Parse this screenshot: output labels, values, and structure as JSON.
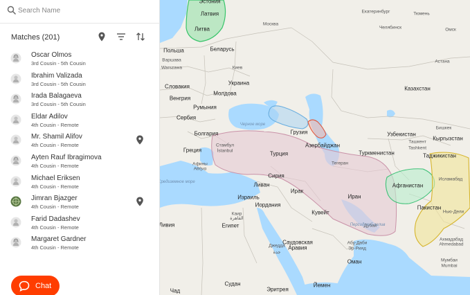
{
  "search": {
    "placeholder": "Search Name"
  },
  "matches": {
    "title": "Matches (201)"
  },
  "colors": {
    "accent": "#ff3d00",
    "sea": "#aadaff",
    "land": "#f1efe9",
    "pin": "#555555"
  },
  "match_list": [
    {
      "name": "Oscar Olmos",
      "relation": "3rd Cousin - 5th Cousin",
      "avatar": "female-avatar-icon",
      "pinned": false
    },
    {
      "name": "Ibrahim Valizada",
      "relation": "3rd Cousin - 5th Cousin",
      "avatar": "male-avatar-icon",
      "pinned": false
    },
    {
      "name": "Irada Balagaeva",
      "relation": "3rd Cousin - 5th Cousin",
      "avatar": "female-avatar-icon",
      "pinned": false
    },
    {
      "name": "Eldar Adilov",
      "relation": "4th Cousin - Remote",
      "avatar": "male-avatar-icon",
      "pinned": false
    },
    {
      "name": "Mr. Shamil Alifov",
      "relation": "4th Cousin - Remote",
      "avatar": "male-avatar-icon",
      "pinned": true
    },
    {
      "name": "Ayten Rauf Ibragimova",
      "relation": "4th Cousin - Remote",
      "avatar": "female-avatar-icon",
      "pinned": false
    },
    {
      "name": "Michael Eriksen",
      "relation": "4th Cousin - Remote",
      "avatar": "male-avatar-icon",
      "pinned": false
    },
    {
      "name": "Jimran Bjazger",
      "relation": "4th Cousin - Remote",
      "avatar": "photo-avatar-icon",
      "pinned": true
    },
    {
      "name": "Farid Dadashev",
      "relation": "4th Cousin - Remote",
      "avatar": "male-avatar-icon",
      "pinned": false
    },
    {
      "name": "Margaret Gardner",
      "relation": "4th Cousin - Remote",
      "avatar": "female-avatar-icon",
      "pinned": false
    }
  ],
  "chat": {
    "label": "Chat"
  },
  "map_labels": [
    {
      "text": "Эстония",
      "kind": "country"
    },
    {
      "text": "Латвия",
      "kind": "country"
    },
    {
      "text": "Литва",
      "kind": "country"
    },
    {
      "text": "Москва",
      "kind": "city"
    },
    {
      "text": "Екатеринбург",
      "kind": "city"
    },
    {
      "text": "Тюмень",
      "kind": "city"
    },
    {
      "text": "Челябинск",
      "kind": "city"
    },
    {
      "text": "Омск",
      "kind": "city"
    },
    {
      "text": "Польша",
      "kind": "country"
    },
    {
      "text": "Варшава",
      "kind": "city"
    },
    {
      "text": "Warszawa",
      "kind": "city"
    },
    {
      "text": "Беларусь",
      "kind": "country"
    },
    {
      "text": "Киев",
      "kind": "city"
    },
    {
      "text": "Украина",
      "kind": "country"
    },
    {
      "text": "Астана",
      "kind": "city"
    },
    {
      "text": "Словакия",
      "kind": "country"
    },
    {
      "text": "Венгрия",
      "kind": "country"
    },
    {
      "text": "Молдова",
      "kind": "country"
    },
    {
      "text": "Казахстан",
      "kind": "country"
    },
    {
      "text": "Румыния",
      "kind": "country"
    },
    {
      "text": "Сербия",
      "kind": "country"
    },
    {
      "text": "Болгария",
      "kind": "country"
    },
    {
      "text": "Черное море",
      "kind": "sea"
    },
    {
      "text": "Грузия",
      "kind": "country"
    },
    {
      "text": "Узбекистан",
      "kind": "country"
    },
    {
      "text": "Бишкек",
      "kind": "city"
    },
    {
      "text": "Кыргызстан",
      "kind": "country"
    },
    {
      "text": "Ташкент",
      "kind": "city"
    },
    {
      "text": "Tashkent",
      "kind": "city"
    },
    {
      "text": "Азербайджан",
      "kind": "country"
    },
    {
      "text": "Туркменистан",
      "kind": "country"
    },
    {
      "text": "Греция",
      "kind": "country"
    },
    {
      "text": "Стамбул",
      "kind": "city"
    },
    {
      "text": "İstanbul",
      "kind": "city"
    },
    {
      "text": "Турция",
      "kind": "country"
    },
    {
      "text": "Таджикистан",
      "kind": "country"
    },
    {
      "text": "Афины",
      "kind": "city"
    },
    {
      "text": "Αθήνα",
      "kind": "city"
    },
    {
      "text": "Тегеран",
      "kind": "city"
    },
    {
      "text": "Средиземное море",
      "kind": "sea"
    },
    {
      "text": "Сирия",
      "kind": "country"
    },
    {
      "text": "Ливан",
      "kind": "country"
    },
    {
      "text": "Афганистан",
      "kind": "country"
    },
    {
      "text": "Исламабад",
      "kind": "city"
    },
    {
      "text": "Ирак",
      "kind": "country"
    },
    {
      "text": "Израиль",
      "kind": "country"
    },
    {
      "text": "Иран",
      "kind": "country"
    },
    {
      "text": "Иордания",
      "kind": "country"
    },
    {
      "text": "Кувейт",
      "kind": "country"
    },
    {
      "text": "Пакистан",
      "kind": "country"
    },
    {
      "text": "Нью-Дели",
      "kind": "city"
    },
    {
      "text": "Каир",
      "kind": "city"
    },
    {
      "text": "القاهرة",
      "kind": "city"
    },
    {
      "text": "Ливия",
      "kind": "country"
    },
    {
      "text": "Египет",
      "kind": "country"
    },
    {
      "text": "Дубай",
      "kind": "city"
    },
    {
      "text": "Персидский залив",
      "kind": "sea"
    },
    {
      "text": "Ахмадабад",
      "kind": "city"
    },
    {
      "text": "Ahmedabad",
      "kind": "city"
    },
    {
      "text": "Абу-Даби",
      "kind": "city"
    },
    {
      "text": "Эр-Рияд",
      "kind": "city"
    },
    {
      "text": "Саудовская",
      "kind": "country"
    },
    {
      "text": "Аравия",
      "kind": "country"
    },
    {
      "text": "Джедда",
      "kind": "city"
    },
    {
      "text": "جدة",
      "kind": "city"
    },
    {
      "text": "Оман",
      "kind": "country"
    },
    {
      "text": "Мумбаи",
      "kind": "city"
    },
    {
      "text": "Mumbai",
      "kind": "city"
    },
    {
      "text": "Судан",
      "kind": "country"
    },
    {
      "text": "Чад",
      "kind": "country"
    },
    {
      "text": "Эритрея",
      "kind": "country"
    },
    {
      "text": "Йемен",
      "kind": "country"
    }
  ]
}
